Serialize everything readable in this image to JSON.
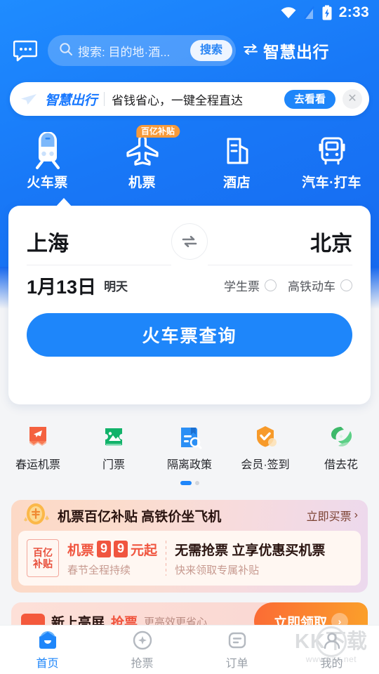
{
  "status_bar": {
    "time": "2:33",
    "icons": [
      "wifi-icon",
      "signal-off-icon",
      "battery-charging-icon"
    ]
  },
  "header": {
    "message_icon": "message-icon",
    "search": {
      "placeholder": "搜索: 目的地·酒...",
      "button_label": "搜索",
      "icon": "search-icon"
    },
    "brand": {
      "label": "智慧出行",
      "icon": "transfer-icon"
    }
  },
  "banner": {
    "brand": "智慧出行",
    "text": "省钱省心，一键全程直达",
    "cta": "去看看",
    "close_icon": "close-icon",
    "logo_icon": "paper-plane-icon"
  },
  "categories": [
    {
      "label": "火车票",
      "icon": "train-icon",
      "badge": null,
      "active": true
    },
    {
      "label": "机票",
      "icon": "airplane-icon",
      "badge": "百亿补贴",
      "active": false
    },
    {
      "label": "酒店",
      "icon": "hotel-icon",
      "badge": null,
      "active": false
    },
    {
      "label": "汽车·打车",
      "icon": "bus-icon",
      "badge": null,
      "active": false
    }
  ],
  "search_card": {
    "from_city": "上海",
    "to_city": "北京",
    "swap_icon": "swap-icon",
    "date": "1月13日",
    "date_sub": "明天",
    "options": [
      {
        "label": "学生票",
        "checked": false
      },
      {
        "label": "高铁动车",
        "checked": false
      }
    ],
    "query_button": "火车票查询"
  },
  "shortcuts": {
    "items": [
      {
        "label": "春运机票",
        "icon": "plane-ticket-icon",
        "color": "#f4613f"
      },
      {
        "label": "门票",
        "icon": "attraction-ticket-icon",
        "color": "#11b26a"
      },
      {
        "label": "隔离政策",
        "icon": "policy-search-icon",
        "color": "#2b8ff5"
      },
      {
        "label": "会员·签到",
        "icon": "member-crown-icon",
        "color": "#f79a2a"
      },
      {
        "label": "借去花",
        "icon": "loan-leaf-icon",
        "color": "#3eb96a"
      }
    ],
    "page_dots": {
      "count": 2,
      "active_index": 0
    }
  },
  "promo_card": {
    "icon": "coin-icon",
    "title": "机票百亿补贴 高铁价坐飞机",
    "link": "立即买票",
    "link_icon": "chevron-right-icon",
    "stamp_line1": "百亿",
    "stamp_line2": "补贴",
    "price_prefix": "机票",
    "price_digits": [
      "9",
      "9"
    ],
    "price_suffix": "元起",
    "price_note": "春节全程持续",
    "right_title": "无需抢票 立享优惠买机票",
    "right_note": "快来领取专属补贴"
  },
  "peek_card": {
    "icon": "ticket-icon",
    "text1": "新上亮屏",
    "text2": "抢票",
    "text3": "更高效更省心",
    "cta": "立即领取",
    "cta_icon": "arrow-right-circle-icon"
  },
  "tabbar": [
    {
      "label": "首页",
      "icon": "home-icon",
      "active": true
    },
    {
      "label": "抢票",
      "icon": "grab-ticket-icon",
      "active": false
    },
    {
      "label": "订单",
      "icon": "order-icon",
      "active": false
    },
    {
      "label": "我的",
      "icon": "profile-icon",
      "active": false
    }
  ],
  "watermark": {
    "main": "KK下载",
    "sub": "www.kkx.net"
  },
  "colors": {
    "primary": "#1e86fa",
    "hero": "#1878f7",
    "badge_orange": "#f79a3a",
    "promo_red": "#f0553f",
    "page_bg": "#f4f5f7"
  }
}
